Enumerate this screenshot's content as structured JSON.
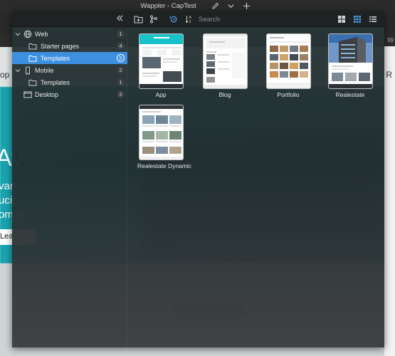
{
  "window": {
    "title": "Wappler - CapTest"
  },
  "background": {
    "hero_word": "Av",
    "hero_lines": [
      "vari",
      "ucin",
      "omm"
    ],
    "left_edge_char": "op",
    "right_edge_char": "R",
    "learn_button": "Lea",
    "ruler_right": "99"
  },
  "sidebar": {
    "items": [
      {
        "label": "Web",
        "count": "1"
      },
      {
        "label": "Starter pages",
        "count": "4"
      },
      {
        "label": "Templates",
        "count": "5"
      },
      {
        "label": "Mobile",
        "count": "2"
      },
      {
        "label": "Templates",
        "count": "1"
      },
      {
        "label": "Desktop",
        "count": "2"
      }
    ]
  },
  "toolbar": {
    "search_placeholder": "Search"
  },
  "templates": [
    {
      "label": "App"
    },
    {
      "label": "Blog"
    },
    {
      "label": "Portfolio"
    },
    {
      "label": "Realestate"
    },
    {
      "label": "Realestate Dynamic"
    }
  ],
  "colors": {
    "selection": "#3d8fe0",
    "accent_blue": "#4aa3f0",
    "hero_teal": "#1aa5b0"
  }
}
